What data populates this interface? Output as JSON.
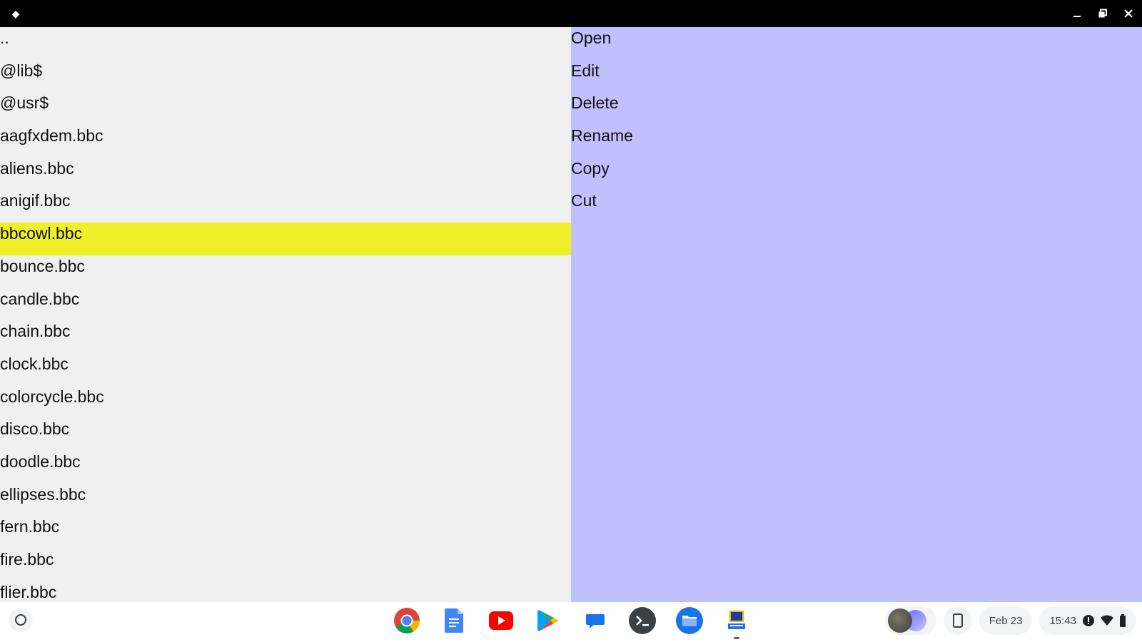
{
  "window": {
    "app_icon": "app-diamond-icon",
    "controls": [
      "minimize-icon",
      "restore-icon",
      "close-icon"
    ]
  },
  "files": [
    "..",
    "@lib$",
    "@usr$",
    "aagfxdem.bbc",
    "aliens.bbc",
    "anigif.bbc",
    "bbcowl.bbc",
    "bounce.bbc",
    "candle.bbc",
    "chain.bbc",
    "clock.bbc",
    "colorcycle.bbc",
    "disco.bbc",
    "doodle.bbc",
    "ellipses.bbc",
    "fern.bbc",
    "fire.bbc",
    "flier.bbc"
  ],
  "selected_file": "bbcowl.bbc",
  "menu": [
    "Open",
    "Edit",
    "Delete",
    "Rename",
    "Copy",
    "Cut"
  ],
  "colors": {
    "file_pane_bg": "#f0f0f0",
    "selected_bg": "#f0f02a",
    "menu_pane_bg": "#c0c0ff",
    "titlebar_bg": "#000000"
  },
  "shelf": {
    "apps": [
      "chrome-icon",
      "docs-icon",
      "youtube-icon",
      "play-store-icon",
      "messages-icon",
      "terminal-icon",
      "files-icon",
      "bbc-basic-icon"
    ],
    "date": "Feb 23",
    "time": "15:43"
  }
}
